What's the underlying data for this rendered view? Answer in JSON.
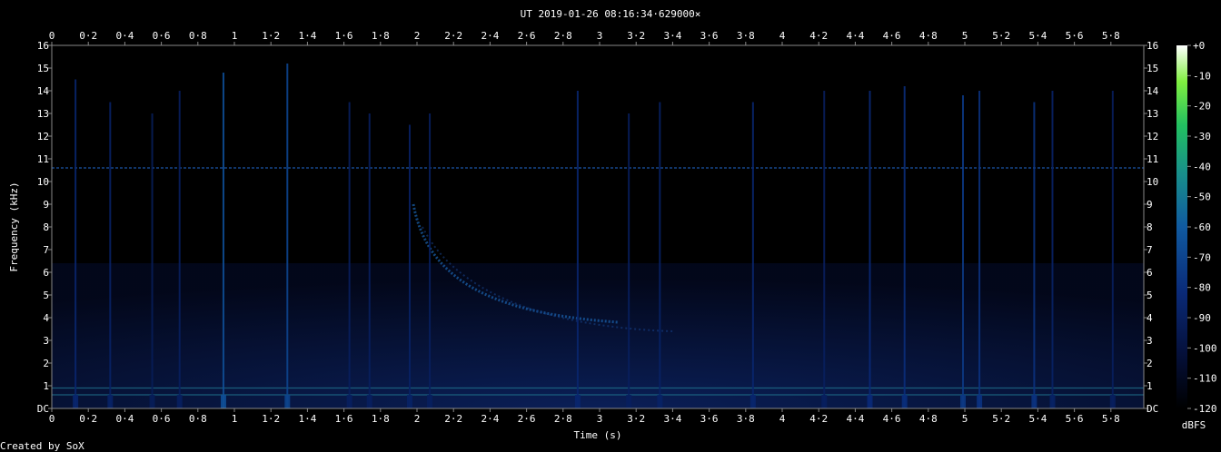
{
  "chart_data": {
    "type": "heatmap",
    "title": "UT 2019-01-26 08:16:34·629000×",
    "xlabel": "Time (s)",
    "ylabel": "Frequency (kHz)",
    "xlim": [
      0,
      5.98
    ],
    "ylim": [
      0,
      16
    ],
    "x_ticks": [
      "0",
      "0·2",
      "0·4",
      "0·6",
      "0·8",
      "1",
      "1·2",
      "1·4",
      "1·6",
      "1·8",
      "2",
      "2·2",
      "2·4",
      "2·6",
      "2·8",
      "3",
      "3·2",
      "3·4",
      "3·6",
      "3·8",
      "4",
      "4·2",
      "4·4",
      "4·6",
      "4·8",
      "5",
      "5·2",
      "5·4",
      "5·6",
      "5·8"
    ],
    "y_ticks": [
      "DC",
      "1",
      "2",
      "3",
      "4",
      "5",
      "6",
      "7",
      "8",
      "9",
      "10",
      "11",
      "12",
      "13",
      "14",
      "15",
      "16"
    ],
    "colorbar": {
      "label": "dBFS",
      "range": [
        -120,
        0
      ],
      "ticks": [
        "+0",
        "-10",
        "-20",
        "-30",
        "-40",
        "-50",
        "-60",
        "-70",
        "-80",
        "-90",
        "-100",
        "-110",
        "-120"
      ],
      "colors": [
        "#000000",
        "#05103a",
        "#0a2a78",
        "#105aa0",
        "#18908a",
        "#22c060",
        "#80f040",
        "#ffffff"
      ]
    },
    "grid": false,
    "features": {
      "background_line_khz": 10.6,
      "low_freq_lines_khz": [
        0.6,
        0.9
      ],
      "whistler": {
        "start_time_s": 1.98,
        "start_khz": 9,
        "end_time_s": 3.1,
        "end_khz": 3.8
      },
      "impulses": [
        {
          "t": 0.13,
          "top": 14.5,
          "level": -85
        },
        {
          "t": 0.32,
          "top": 13.5,
          "level": -88
        },
        {
          "t": 0.55,
          "top": 13.0,
          "level": -92
        },
        {
          "t": 0.7,
          "top": 14.0,
          "level": -90
        },
        {
          "t": 0.94,
          "top": 14.8,
          "level": -65
        },
        {
          "t": 1.29,
          "top": 15.2,
          "level": -70
        },
        {
          "t": 1.63,
          "top": 13.5,
          "level": -90
        },
        {
          "t": 1.74,
          "top": 13.0,
          "level": -90
        },
        {
          "t": 1.96,
          "top": 12.5,
          "level": -88
        },
        {
          "t": 2.07,
          "top": 13.0,
          "level": -90
        },
        {
          "t": 2.88,
          "top": 14.0,
          "level": -85
        },
        {
          "t": 3.16,
          "top": 13.0,
          "level": -90
        },
        {
          "t": 3.33,
          "top": 13.5,
          "level": -88
        },
        {
          "t": 3.84,
          "top": 13.5,
          "level": -85
        },
        {
          "t": 4.23,
          "top": 14.0,
          "level": -90
        },
        {
          "t": 4.48,
          "top": 14.0,
          "level": -82
        },
        {
          "t": 4.67,
          "top": 14.2,
          "level": -80
        },
        {
          "t": 4.99,
          "top": 13.8,
          "level": -75
        },
        {
          "t": 5.08,
          "top": 14.0,
          "level": -78
        },
        {
          "t": 5.38,
          "top": 13.5,
          "level": -78
        },
        {
          "t": 5.48,
          "top": 14.0,
          "level": -88
        },
        {
          "t": 5.81,
          "top": 14.0,
          "level": -90
        }
      ]
    }
  },
  "footer": {
    "credit": "Created by SoX"
  }
}
